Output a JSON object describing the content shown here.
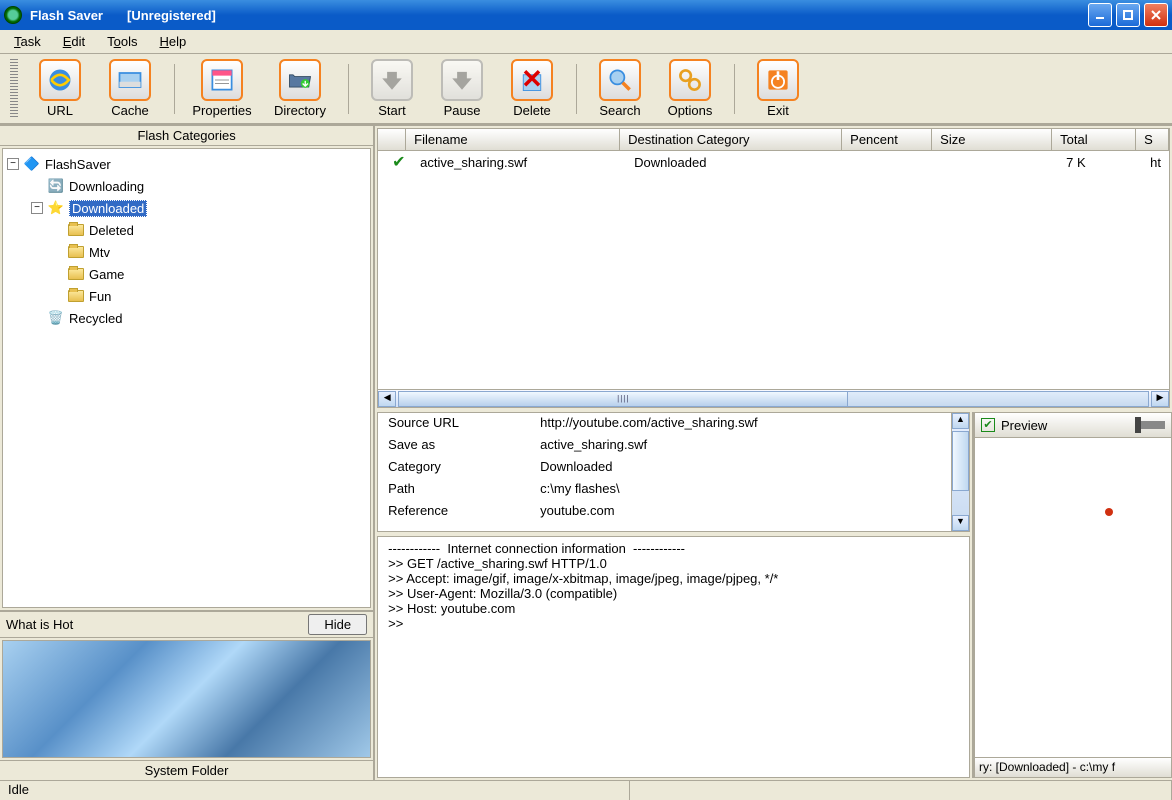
{
  "title": {
    "app": "Flash Saver",
    "status": "[Unregistered]"
  },
  "menu": {
    "task": "Task",
    "edit": "Edit",
    "tools": "Tools",
    "help": "Help"
  },
  "toolbar": {
    "url": "URL",
    "cache": "Cache",
    "properties": "Properties",
    "directory": "Directory",
    "start": "Start",
    "pause": "Pause",
    "delete": "Delete",
    "search": "Search",
    "options": "Options",
    "exit": "Exit"
  },
  "sidebar": {
    "header": "Flash Categories",
    "root": "FlashSaver",
    "items": {
      "downloading": "Downloading",
      "downloaded": "Downloaded",
      "deleted": "Deleted",
      "mtv": "Mtv",
      "game": "Game",
      "fun": "Fun",
      "recycled": "Recycled"
    }
  },
  "hot": {
    "title": "What is Hot",
    "hide": "Hide",
    "footer": "System Folder"
  },
  "columns": {
    "filename": "Filename",
    "dest": "Destination Category",
    "percent": "Pencent",
    "size": "Size",
    "total": "Total",
    "s": "S"
  },
  "colw": {
    "check": "28px",
    "filename": "214px",
    "dest": "222px",
    "percent": "90px",
    "size": "120px",
    "total": "84px"
  },
  "file": {
    "name": "active_sharing.swf",
    "dest": "Downloaded",
    "percent": "",
    "size": "",
    "total": "7 K",
    "s": "ht"
  },
  "details": {
    "l_source": "Source URL",
    "v_source": "http://youtube.com/active_sharing.swf",
    "l_save": "Save as",
    "v_save": "active_sharing.swf",
    "l_cat": "Category",
    "v_cat": "Downloaded",
    "l_path": "Path",
    "v_path": "c:\\my flashes\\",
    "l_ref": "Reference",
    "v_ref": "youtube.com"
  },
  "log": {
    "l0": "------------  Internet connection information  ------------",
    "l1": ">> GET /active_sharing.swf HTTP/1.0",
    "l2": ">> Accept: image/gif, image/x-xbitmap, image/jpeg, image/pjpeg, */*",
    "l3": ">> User-Agent: Mozilla/3.0 (compatible)",
    "l4": ">> Host: youtube.com",
    "l5": ">>"
  },
  "preview": {
    "label": "Preview",
    "footer": "ry: [Downloaded] - c:\\my f"
  },
  "status": {
    "idle": "Idle"
  }
}
